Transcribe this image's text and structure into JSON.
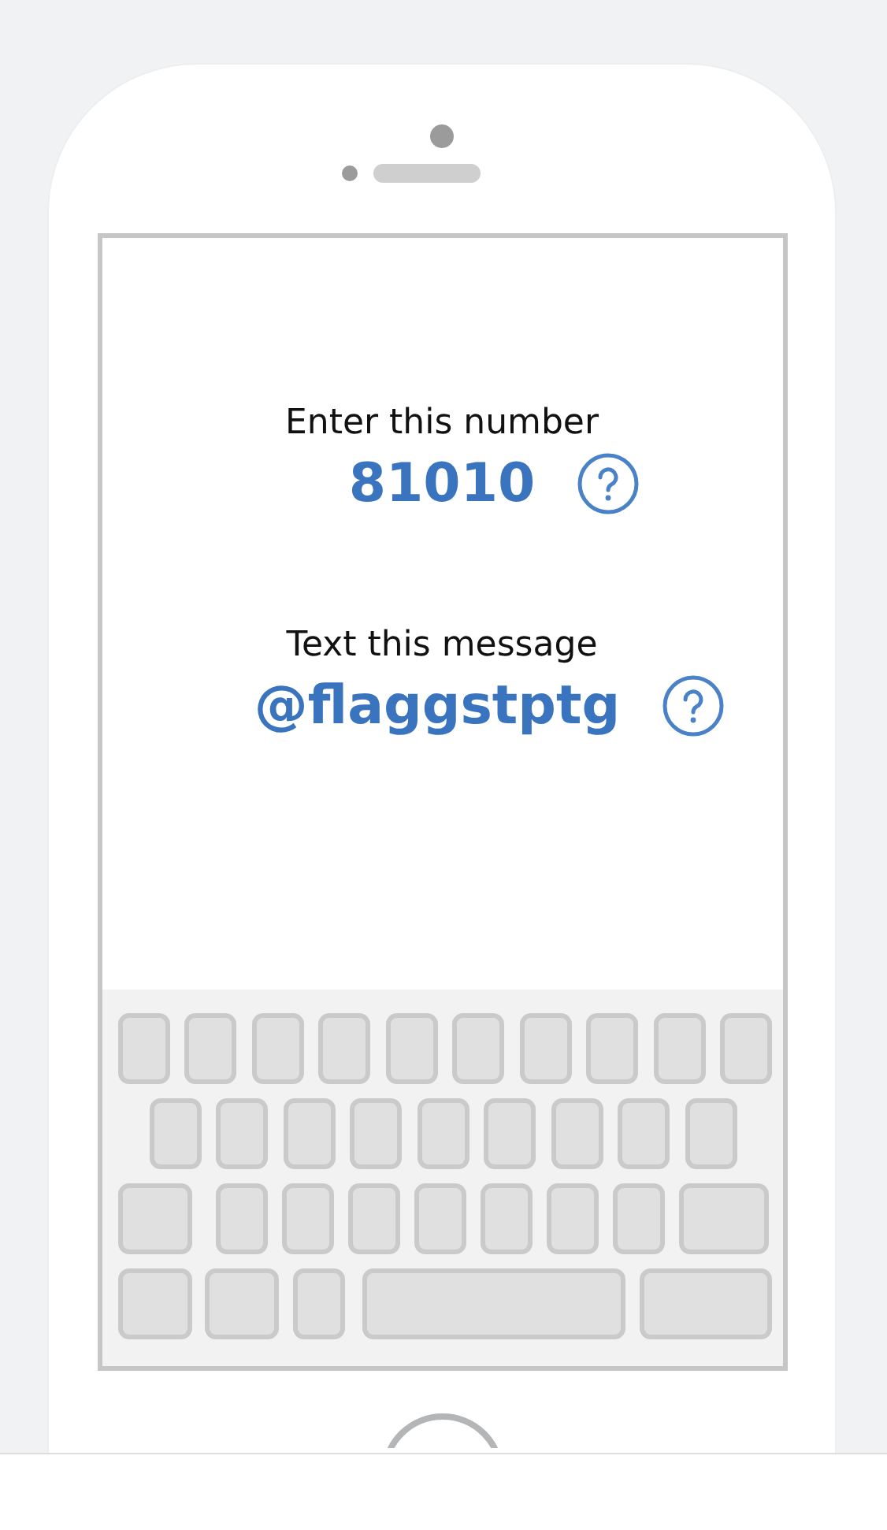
{
  "steps": [
    {
      "label": "Enter this number",
      "value": "81010"
    },
    {
      "label": "Text this message",
      "value": "@flaggstptg"
    }
  ]
}
